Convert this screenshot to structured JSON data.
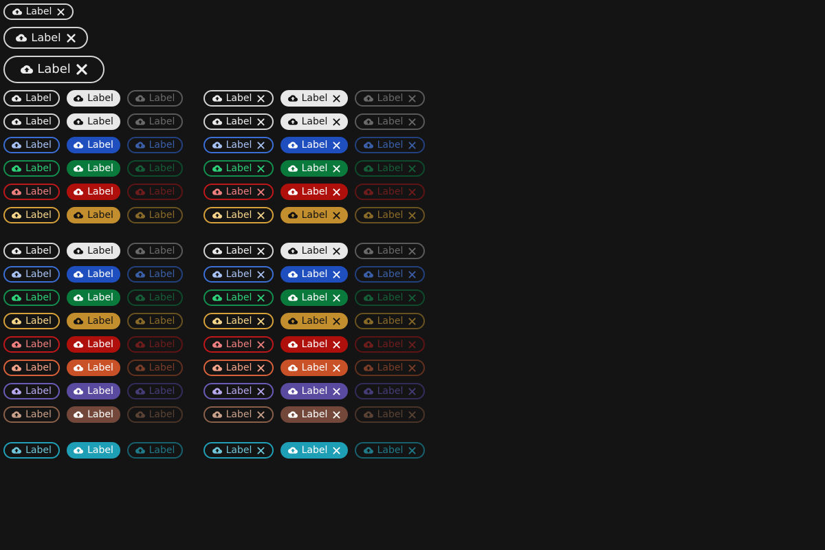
{
  "chip_label": "Label",
  "icons": {
    "leading": "cloud-upload-icon",
    "trailing": "close-icon"
  },
  "size_demos": [
    {
      "size": "small",
      "label": "Label"
    },
    {
      "size": "medium",
      "label": "Label"
    },
    {
      "size": "large",
      "label": "Label"
    }
  ],
  "groups": [
    {
      "name": "group-1",
      "colors": [
        "default",
        "secondary",
        "primary",
        "success",
        "error",
        "warning"
      ]
    },
    {
      "name": "group-2",
      "colors": [
        "secondary",
        "primary",
        "success",
        "warning",
        "error",
        "orange",
        "purple",
        "brown"
      ]
    },
    {
      "name": "group-3",
      "colors": [
        "cyan"
      ]
    }
  ],
  "variants": [
    "outlined",
    "filled",
    "disabled"
  ],
  "palette": {
    "default": {
      "outline": "#d4d4d4",
      "outline_text": "#ededed",
      "fill": "#e8e8e8",
      "fill_text": "#111111",
      "dis": "#5a5a5a",
      "dis_text": "#6a6a6a"
    },
    "secondary": {
      "outline": "#d4d4d4",
      "outline_text": "#ededed",
      "fill": "#e8e8e8",
      "fill_text": "#111111",
      "dis": "#5a5a5a",
      "dis_text": "#6a6a6a"
    },
    "primary": {
      "outline": "#3b6fd6",
      "outline_text": "#a8c2f5",
      "fill": "#1f4fbf",
      "fill_text": "#ffffff",
      "dis": "#23407f",
      "dis_text": "#3a5fa8"
    },
    "success": {
      "outline": "#13904f",
      "outline_text": "#2ed07a",
      "fill": "#0a7a3c",
      "fill_text": "#ffffff",
      "dis": "#0e4a2c",
      "dis_text": "#155e38"
    },
    "error": {
      "outline": "#c0171a",
      "outline_text": "#f08080",
      "fill": "#b0100c",
      "fill_text": "#ffffff",
      "dis": "#5e1414",
      "dis_text": "#6e1c1c"
    },
    "warning": {
      "outline": "#d8a23a",
      "outline_text": "#f7d58a",
      "fill": "#c38f2e",
      "fill_text": "#111111",
      "dis": "#6a5220",
      "dis_text": "#8a6a28"
    },
    "orange": {
      "outline": "#d9623a",
      "outline_text": "#f4a48a",
      "fill": "#c85128",
      "fill_text": "#ffffff",
      "dis": "#62301e",
      "dis_text": "#7a3e28"
    },
    "purple": {
      "outline": "#6b5bb8",
      "outline_text": "#b8a8f0",
      "fill": "#5a4aa0",
      "fill_text": "#ffffff",
      "dis": "#332c5a",
      "dis_text": "#453c78"
    },
    "brown": {
      "outline": "#8a604a",
      "outline_text": "#c9a08a",
      "fill": "#73483a",
      "fill_text": "#ffffff",
      "dis": "#4a3428",
      "dis_text": "#5a4234"
    },
    "cyan": {
      "outline": "#1fa0b8",
      "outline_text": "#6ec6d8",
      "fill": "#1e9fb6",
      "fill_text": "#ffffff",
      "dis": "#17606e",
      "dis_text": "#1f7a8a"
    }
  }
}
